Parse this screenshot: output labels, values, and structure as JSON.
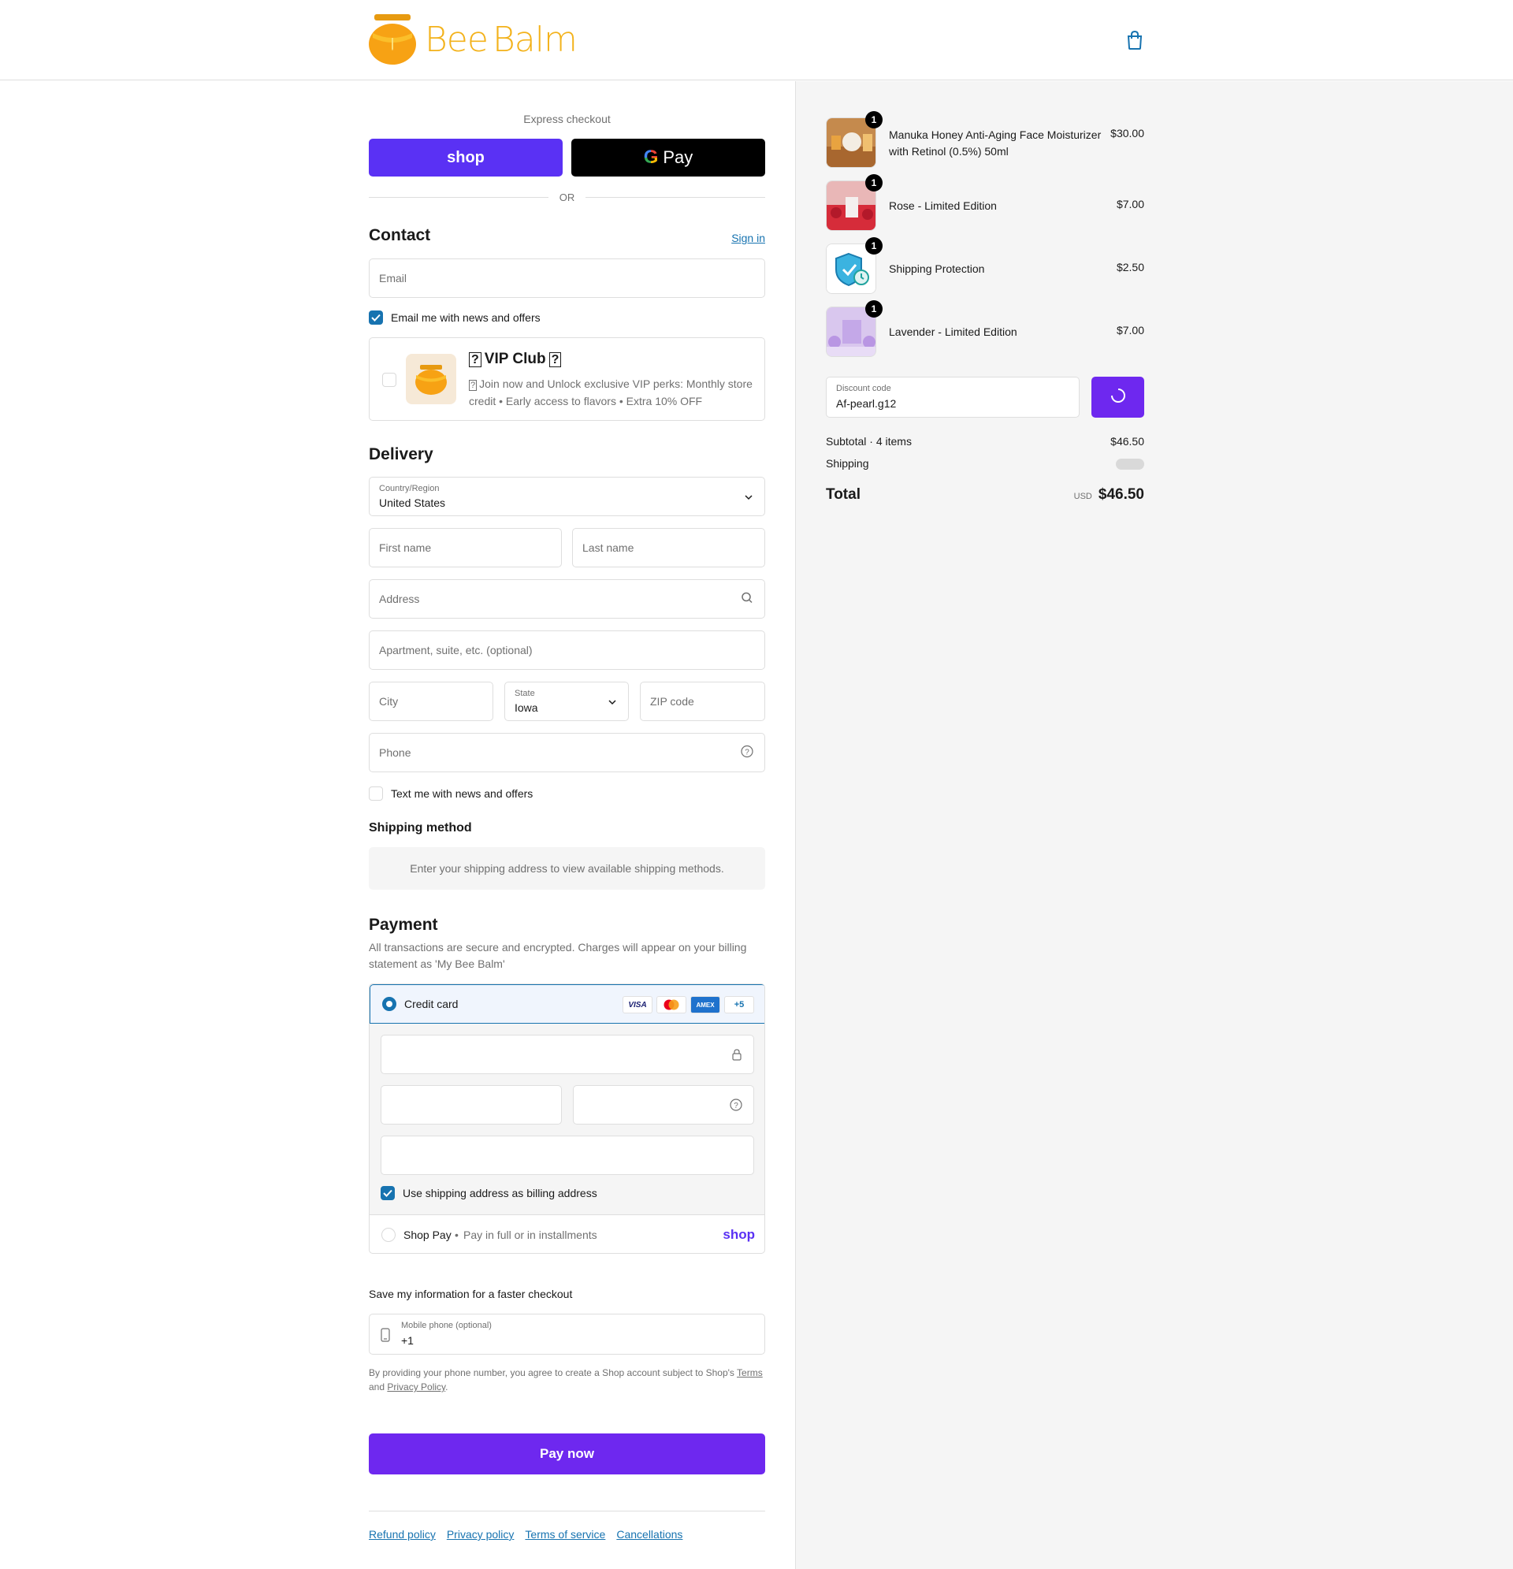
{
  "header": {
    "brand": "BeeBalm",
    "brand_parts": [
      "Bee",
      "Balm"
    ]
  },
  "express": {
    "title": "Express checkout",
    "shop_label": "shop",
    "gpay_label": "Pay",
    "or": "OR"
  },
  "contact": {
    "title": "Contact",
    "sign_in": "Sign in",
    "email_placeholder": "Email",
    "news_label": "Email me with news and offers",
    "news_checked": true
  },
  "vip": {
    "title": "VIP Club",
    "desc": "Join now and Unlock exclusive VIP perks: Monthly store credit • Early access to flavors • Extra 10% OFF"
  },
  "delivery": {
    "title": "Delivery",
    "country_label": "Country/Region",
    "country_value": "United States",
    "first_name": "First name",
    "last_name": "Last name",
    "address": "Address",
    "apartment": "Apartment, suite, etc. (optional)",
    "city": "City",
    "state_label": "State",
    "state_value": "Iowa",
    "zip": "ZIP code",
    "phone": "Phone",
    "text_label": "Text me with news and offers"
  },
  "shipping_method": {
    "title": "Shipping method",
    "note": "Enter your shipping address to view available shipping methods."
  },
  "payment": {
    "title": "Payment",
    "desc": "All transactions are secure and encrypted. Charges will appear on your billing statement as 'My Bee Balm'",
    "credit_card": "Credit card",
    "cards": [
      "VISA",
      "MC",
      "AMEX",
      "+5"
    ],
    "billing_label": "Use shipping address as billing address",
    "shop_pay": "Shop Pay",
    "shop_pay_desc": "Pay in full or in installments",
    "shop_pay_logo": "shop"
  },
  "save_info": {
    "title": "Save my information for a faster checkout",
    "mobile_label": "Mobile phone (optional)",
    "mobile_value": "+1",
    "legal_prefix": "By providing your phone number, you agree to create a Shop account subject to Shop's",
    "terms": "Terms",
    "and": "and",
    "privacy": "Privacy Policy",
    "period": "."
  },
  "pay_now": "Pay now",
  "footer": [
    "Refund policy",
    "Privacy policy",
    "Terms of service",
    "Cancellations"
  ],
  "cart": {
    "items": [
      {
        "name": "Manuka Honey Anti-Aging Face Moisturizer with Retinol (0.5%) 50ml",
        "price": "$30.00",
        "qty": "1"
      },
      {
        "name": "Rose - Limited Edition",
        "price": "$7.00",
        "qty": "1"
      },
      {
        "name": "Shipping Protection",
        "price": "$2.50",
        "qty": "1"
      },
      {
        "name": "Lavender - Limited Edition",
        "price": "$7.00",
        "qty": "1"
      }
    ],
    "discount_label": "Discount code",
    "discount_value": "Af-pearl.g12",
    "subtotal_label": "Subtotal · 4 items",
    "subtotal_value": "$46.50",
    "shipping_label": "Shipping",
    "total_label": "Total",
    "currency": "USD",
    "total_value": "$46.50"
  },
  "colors": {
    "accent": "#6e28ef",
    "shop_purple": "#5a31f4",
    "link": "#1773b0",
    "brand": "#f3b21b"
  }
}
